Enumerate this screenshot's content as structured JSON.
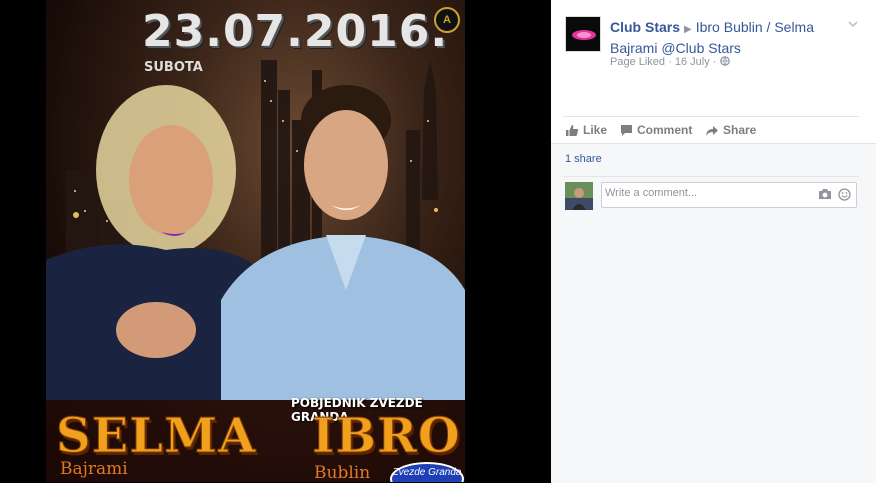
{
  "poster": {
    "date": "23.07.2016.",
    "day": "SUBOTA",
    "badge": "A",
    "winner_caption": "POBJEDNIK ZVEZDE GRANDA",
    "artist1_first": "SELMA",
    "artist1_last": "Bajrami",
    "artist2_first": "IBRO",
    "artist2_last": "Bublin",
    "logo_text": "Zvezde Granda"
  },
  "post": {
    "page_name": "Club Stars",
    "title_rest": "Ibro Bublin / Selma Bajrami @Club Stars",
    "meta_status": "Page Liked",
    "meta_dot": "·",
    "meta_date": "16 July",
    "meta_dot2": "·",
    "audience_icon": "globe-icon"
  },
  "actions": {
    "like_label": "Like",
    "comment_label": "Comment",
    "share_label": "Share"
  },
  "feedback": {
    "shares_text": "1 share",
    "comment_placeholder": "Write a comment..."
  },
  "colors": {
    "link": "#365899",
    "muted": "#90949c",
    "action": "#7f7f7f",
    "feedback_bg": "#f6f7f9"
  }
}
